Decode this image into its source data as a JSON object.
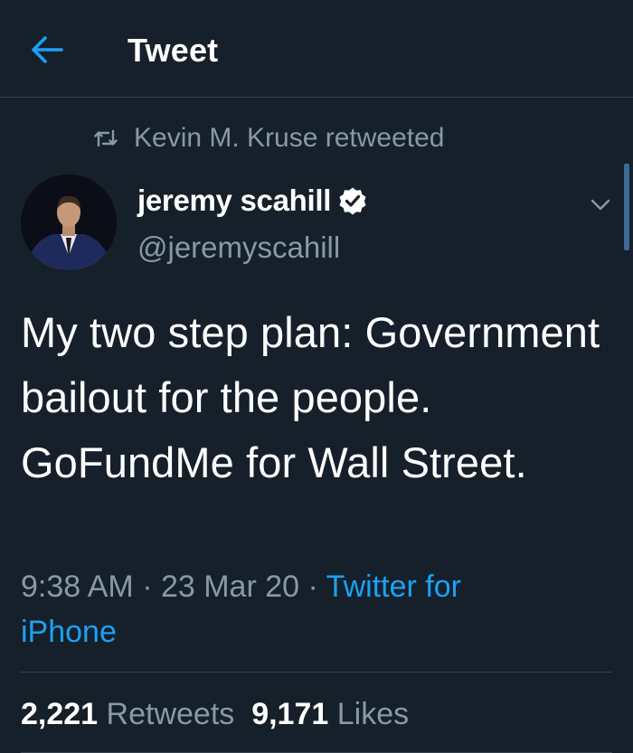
{
  "header": {
    "title": "Tweet",
    "back_icon": "arrow-left-icon",
    "accent": "#1da1f2"
  },
  "retweet": {
    "icon": "retweet-icon",
    "text": "Kevin M. Kruse retweeted"
  },
  "author": {
    "name": "jeremy scahill",
    "handle": "@jeremyscahill",
    "verified_icon": "verified-badge-icon"
  },
  "tweet": {
    "text": "My two step plan: Government bailout for the people. GoFundMe for Wall Street.",
    "time": "9:38 AM",
    "sep1": " · ",
    "date": "23 Mar 20",
    "sep2": " · ",
    "source": "Twitter for iPhone"
  },
  "stats": {
    "retweets_count": "2,221",
    "retweets_label": "Retweets",
    "likes_count": "9,171",
    "likes_label": "Likes"
  },
  "colors": {
    "background": "#15202b",
    "secondary_text": "#8899a6",
    "divider": "#38444d",
    "link": "#1da1f2"
  }
}
